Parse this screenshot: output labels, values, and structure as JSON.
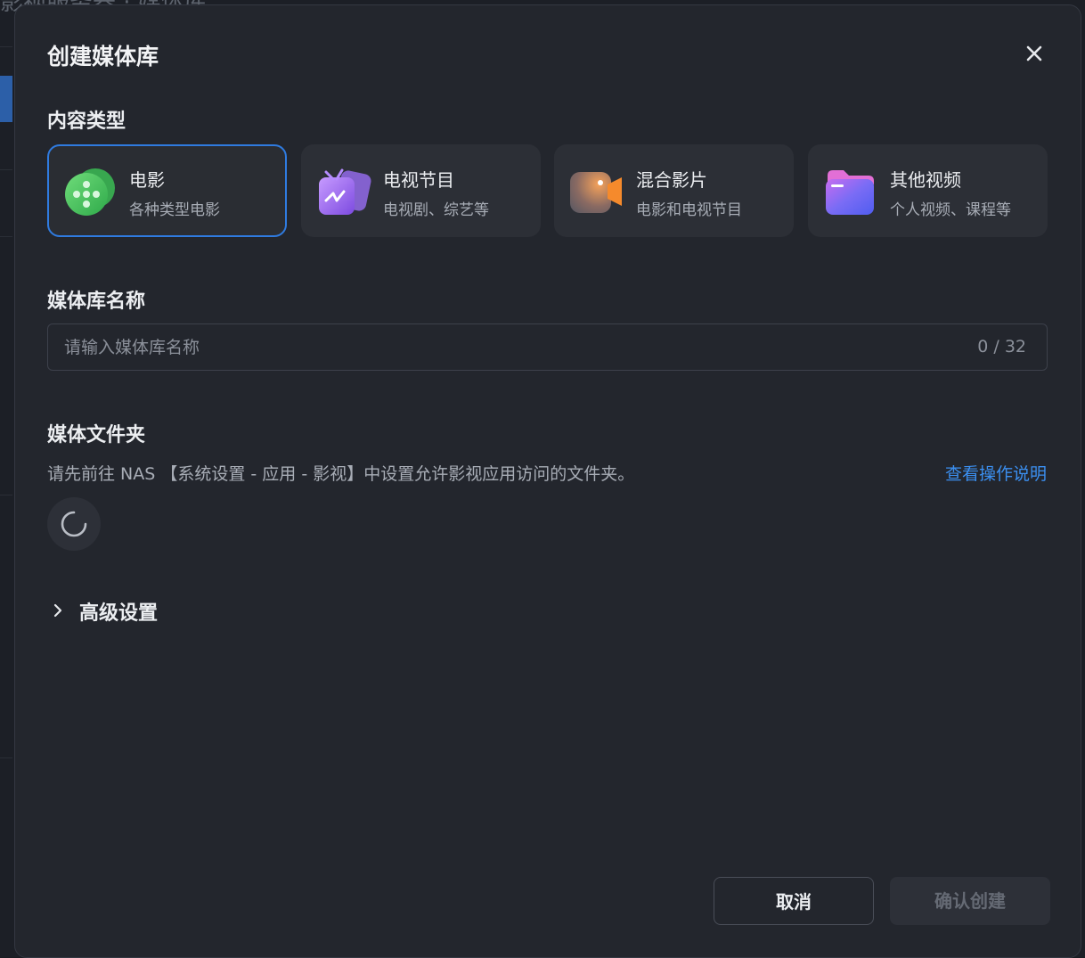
{
  "background": {
    "title_fragment": "影视服务器 · 媒体库"
  },
  "modal": {
    "title": "创建媒体库",
    "close_icon": "close-icon"
  },
  "content_type": {
    "label": "内容类型",
    "cards": [
      {
        "title": "电影",
        "subtitle": "各种类型电影",
        "icon": "film-reel-icon",
        "selected": true
      },
      {
        "title": "电视节目",
        "subtitle": "电视剧、综艺等",
        "icon": "tv-icon",
        "selected": false
      },
      {
        "title": "混合影片",
        "subtitle": "电影和电视节目",
        "icon": "video-camera-icon",
        "selected": false
      },
      {
        "title": "其他视频",
        "subtitle": "个人视频、课程等",
        "icon": "folder-icon",
        "selected": false
      }
    ]
  },
  "library_name": {
    "label": "媒体库名称",
    "placeholder": "请输入媒体库名称",
    "value": "",
    "counter": "0 / 32"
  },
  "media_folder": {
    "label": "媒体文件夹",
    "hint": "请先前往 NAS 【系统设置 - 应用 - 影视】中设置允许影视应用访问的文件夹。",
    "help_link": "查看操作说明",
    "spinner_icon": "loading-spinner-icon"
  },
  "advanced": {
    "label": "高级设置",
    "icon": "chevron-right-icon"
  },
  "footer": {
    "cancel_label": "取消",
    "confirm_label": "确认创建"
  },
  "colors": {
    "accent": "#2f7be0",
    "link": "#3b8ff0",
    "modal_bg": "#23262d"
  }
}
